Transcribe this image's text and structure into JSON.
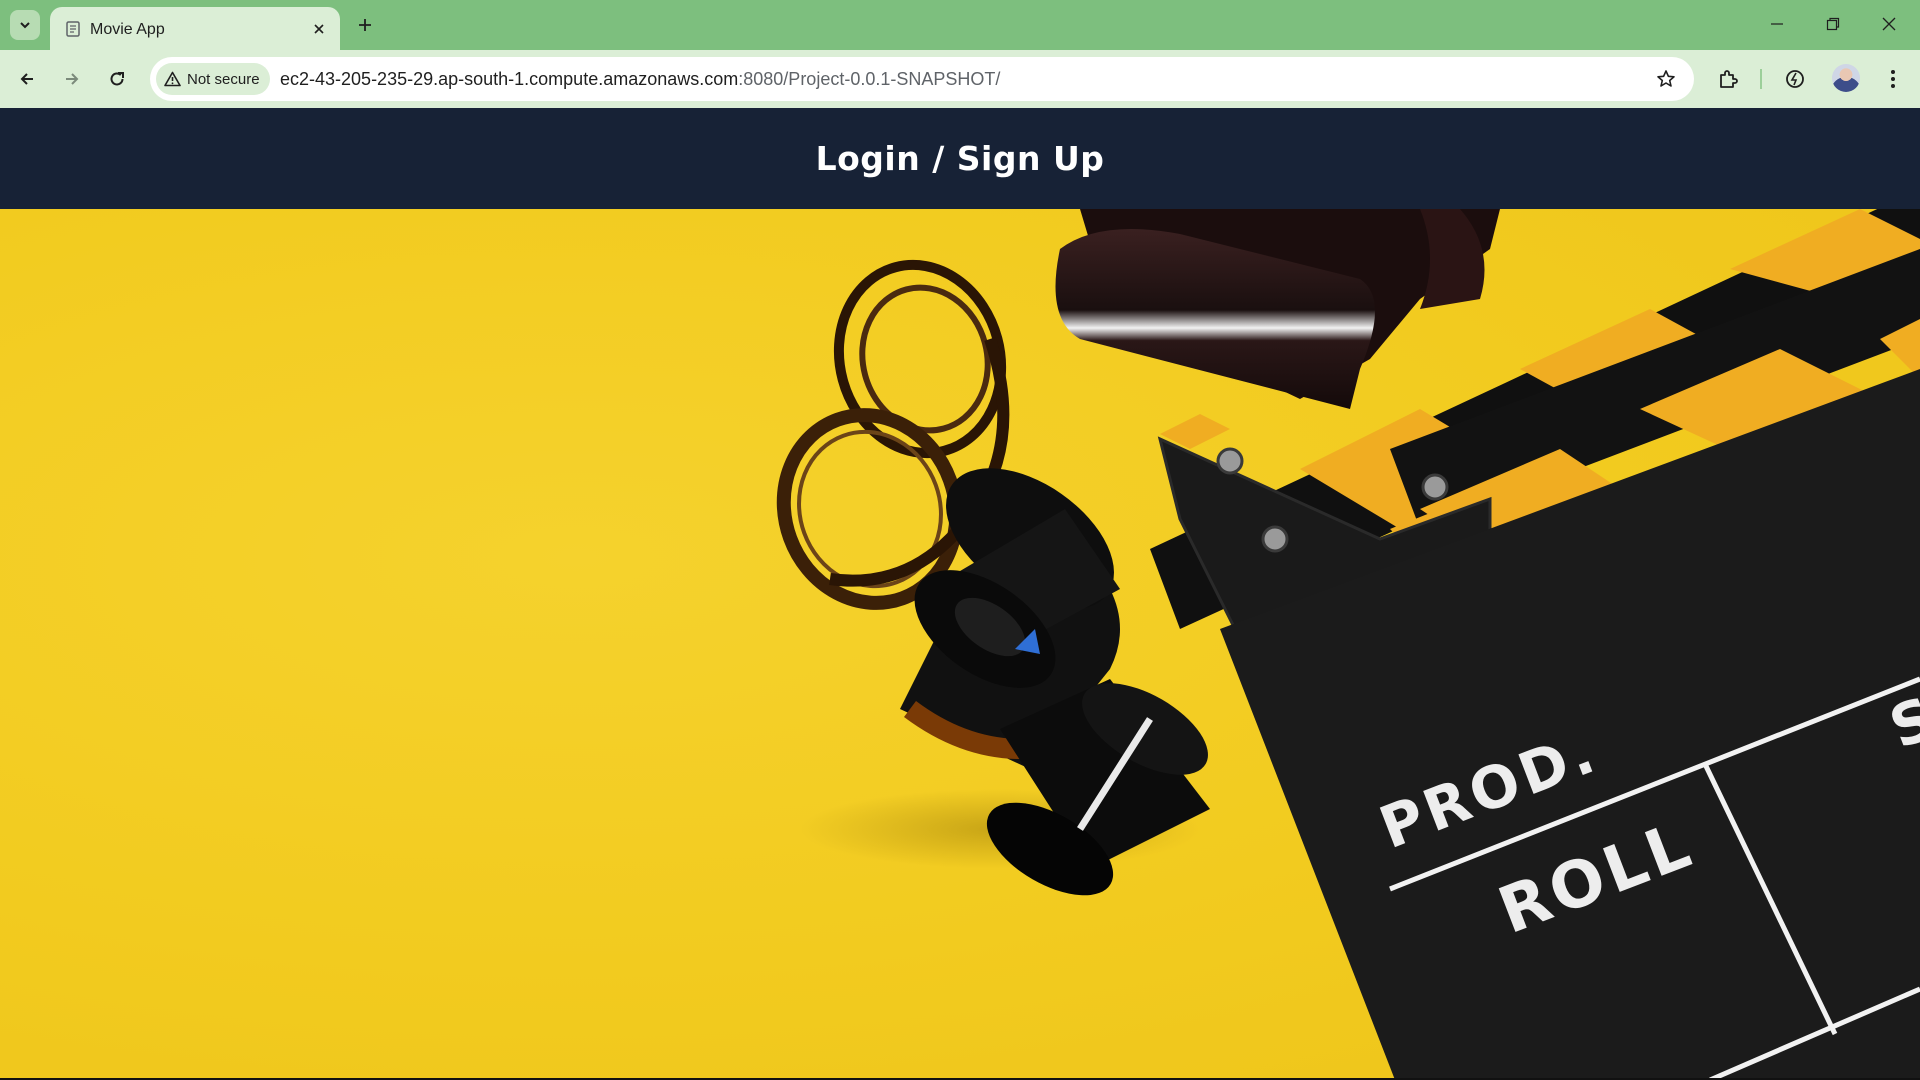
{
  "browser": {
    "tab": {
      "title": "Movie App"
    },
    "address_bar": {
      "security_label": "Not secure",
      "url_host": "ec2-43-205-235-29.ap-south-1.compute.amazonaws.com",
      "url_rest": ":8080/Project-0.0.1-SNAPSHOT/"
    },
    "icons": {
      "tab_search": "chevron-down-icon",
      "favicon": "page-icon",
      "close": "close-icon",
      "new_tab": "plus-icon",
      "back": "arrow-left-icon",
      "forward": "arrow-right-icon",
      "reload": "reload-icon",
      "warning": "warning-triangle-icon",
      "bookmark": "star-icon",
      "extensions": "puzzle-icon",
      "performance": "gauge-icon",
      "menu": "kebab-menu-icon"
    }
  },
  "page": {
    "header_title": "Login / Sign Up",
    "hero": {
      "description_colors": {
        "background": "#f2cb1f",
        "header": "#172236"
      },
      "clapperboard_text": {
        "prod": "PROD.",
        "roll": "ROLL",
        "partial": "S"
      }
    }
  }
}
